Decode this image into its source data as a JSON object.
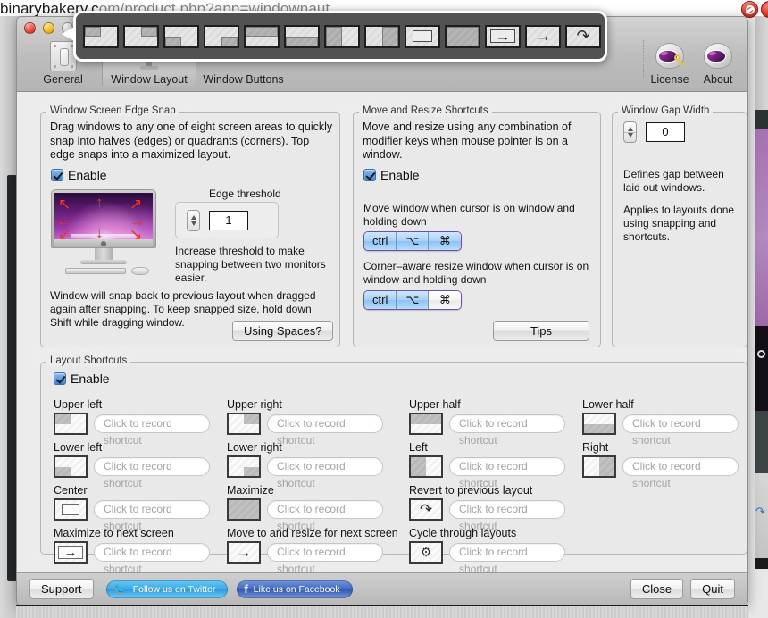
{
  "browser": {
    "url_visible": "binarybakery.com/product.php?app=windownaut",
    "url_head": "binarybakery.c",
    "url_tail": "om/product.php?app=windownaut",
    "close_badge": "close-badge"
  },
  "window": {
    "traffic_lights": [
      "close",
      "minimize",
      "zoom"
    ],
    "toolbar": {
      "items": [
        {
          "label": "General",
          "icon": "toggle-switch-icon",
          "selected": false
        },
        {
          "label": "Window Layout",
          "icon": "monitor-layout-icon",
          "selected": true
        },
        {
          "label": "Window Buttons",
          "icon": "window-buttons-icon",
          "selected": false
        }
      ],
      "right_items": [
        {
          "label": "License",
          "icon": "astronaut-helmet-key-icon"
        },
        {
          "label": "About",
          "icon": "astronaut-helmet-icon"
        }
      ]
    }
  },
  "popup_palette": {
    "name": "window-layout-palette",
    "icons": [
      "upper-left-layout",
      "upper-right-layout",
      "lower-left-layout",
      "lower-right-layout",
      "upper-half-layout",
      "lower-half-layout",
      "left-half-layout",
      "right-half-layout",
      "center-layout",
      "maximize-layout",
      "maximize-next-screen-layout",
      "move-next-screen-layout",
      "revert-layout"
    ]
  },
  "panels": {
    "edge_snap": {
      "title": "Window Screen Edge Snap",
      "description": "Drag windows to any one of eight screen areas to quickly snap into halves (edges) or quadrants (corners). Top edge snaps into a maximized layout.",
      "enable_label": "Enable",
      "enable_checked": true,
      "threshold_label": "Edge threshold",
      "threshold_value": "1",
      "threshold_hint": "Increase threshold to make snapping between two monitors easier.",
      "footer_note": "Window will snap back to previous layout when dragged again after snapping. To keep snapped size, hold down Shift while dragging window.",
      "spaces_button": "Using Spaces?",
      "illustration": "imac-with-eight-red-arrows"
    },
    "move_resize": {
      "title": "Move and Resize Shortcuts",
      "description": "Move and resize using any combination of modifier keys when mouse pointer is on a window.",
      "enable_label": "Enable",
      "enable_checked": true,
      "move_label": "Move window when cursor is on window and holding down",
      "move_keys": [
        {
          "key": "ctrl",
          "selected": true
        },
        {
          "key": "⌥",
          "selected": true
        },
        {
          "key": "⌘",
          "selected": true
        }
      ],
      "resize_label": "Corner–aware resize window when cursor is on window and holding down",
      "resize_keys": [
        {
          "key": "ctrl",
          "selected": true
        },
        {
          "key": "⌥",
          "selected": true
        },
        {
          "key": "⌘",
          "selected": false
        }
      ],
      "tips_button": "Tips"
    },
    "gap_width": {
      "title": "Window Gap Width",
      "value": "0",
      "description_1": "Defines gap between laid out windows.",
      "description_2": "Applies to layouts done using snapping and shortcuts."
    },
    "layout_shortcuts": {
      "title": "Layout Shortcuts",
      "enable_label": "Enable",
      "enable_checked": true,
      "placeholder": "Click to record shortcut",
      "items": [
        {
          "label": "Upper left",
          "icon": "upper-left-layout-icon",
          "value": "",
          "col": 0,
          "row": 0
        },
        {
          "label": "Lower left",
          "icon": "lower-left-layout-icon",
          "value": "",
          "col": 0,
          "row": 1
        },
        {
          "label": "Center",
          "icon": "center-layout-icon",
          "value": "",
          "col": 0,
          "row": 2
        },
        {
          "label": "Maximize to next screen",
          "icon": "maximize-next-screen-icon",
          "value": "",
          "col": 0,
          "row": 3
        },
        {
          "label": "Upper right",
          "icon": "upper-right-layout-icon",
          "value": "",
          "col": 1,
          "row": 0
        },
        {
          "label": "Lower right",
          "icon": "lower-right-layout-icon",
          "value": "",
          "col": 1,
          "row": 1
        },
        {
          "label": "Maximize",
          "icon": "maximize-layout-icon",
          "value": "",
          "col": 1,
          "row": 2
        },
        {
          "label": "Move to and resize for next screen",
          "icon": "move-next-screen-icon",
          "value": "",
          "col": 1,
          "row": 3
        },
        {
          "label": "Upper half",
          "icon": "upper-half-layout-icon",
          "value": "",
          "col": 2,
          "row": 0
        },
        {
          "label": "Left",
          "icon": "left-half-layout-icon",
          "value": "",
          "col": 2,
          "row": 1
        },
        {
          "label": "Revert to previous layout",
          "icon": "revert-layout-icon",
          "value": "",
          "col": 2,
          "row": 2
        },
        {
          "label": "Cycle through layouts",
          "icon": "cycle-layouts-icon",
          "value": "",
          "col": 2,
          "row": 3
        },
        {
          "label": "Lower half",
          "icon": "lower-half-layout-icon",
          "value": "",
          "col": 3,
          "row": 0
        },
        {
          "label": "Right",
          "icon": "right-half-layout-icon",
          "value": "",
          "col": 3,
          "row": 1
        }
      ]
    }
  },
  "bottom_bar": {
    "support_button": "Support",
    "twitter_button": "Follow us on Twitter",
    "facebook_button": "Like us on Facebook",
    "close_button": "Close",
    "quit_button": "Quit"
  },
  "colors": {
    "accent_blue": "#8cc2f4",
    "window_bg": "#ececec",
    "toolbar_top": "#d3d3d3",
    "popup_bg": "#525252",
    "arrow_red": "#ee3a28",
    "twitter_blue": "#3ca9e8",
    "facebook_blue": "#3f68bf"
  }
}
